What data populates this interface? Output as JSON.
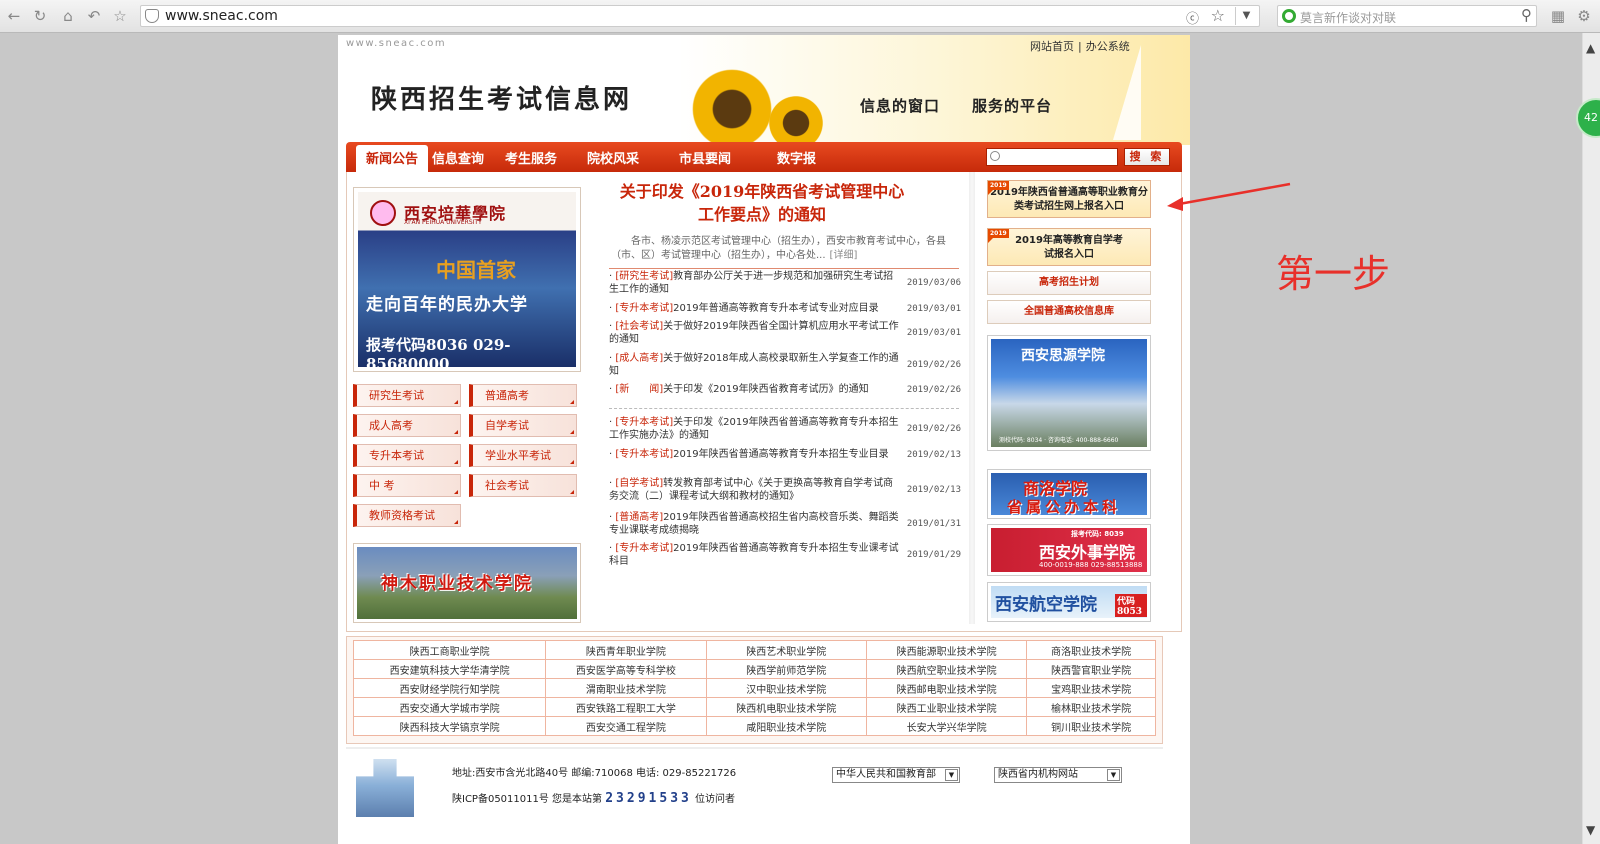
{
  "browser": {
    "url": "www.sneac.com",
    "search_placeholder": "莫言新作谈对对联",
    "badge": "42"
  },
  "site": {
    "domain_mark": "www.sneac.com",
    "title": "陕西招生考试信息网",
    "slogan_left": "信息的窗口",
    "slogan_right": "服务的平台",
    "top_links": [
      "网站首页",
      "办公系统"
    ]
  },
  "nav": {
    "items": [
      "新闻公告",
      "信息查询",
      "考生服务",
      "院校风采",
      "市县要闻",
      "数字报"
    ],
    "search_button": "搜 索"
  },
  "left": {
    "top_ad": {
      "name": "西安培華學院",
      "name_en": "XI'AN PEIHUA UNIVERSITY",
      "slogan_hand": "中国首家",
      "slogan": "走向百年的民办大学",
      "code": "报考代码8036  029-85680000"
    },
    "links": [
      "研究生考试",
      "普通高考",
      "成人高考",
      "自学考试",
      "专升本考试",
      "学业水平考试",
      "中  考",
      "社会考试",
      "教师资格考试"
    ],
    "bottom_ad": "神木职业技术学院"
  },
  "middle": {
    "headline": "关于印发《2019年陕西省考试管理中心工作要点》的通知",
    "summary": "各市、杨凌示范区考试管理中心（招生办），西安市教育考试中心，各县（市、区）考试管理中心（招生办），中心各处...",
    "summary_more": "[详细]",
    "news1": [
      {
        "cat": "[研究生考试]",
        "text": "教育部办公厅关于进一步规范和加强研究生考试招生工作的通知",
        "date": "2019/03/06"
      },
      {
        "cat": "[专升本考试]",
        "text": "2019年普通高等教育专升本考试专业对应目录",
        "date": "2019/03/01"
      },
      {
        "cat": "[社会考试]",
        "text": "关于做好2019年陕西省全国计算机应用水平考试工作的通知",
        "date": "2019/03/01"
      },
      {
        "cat": "[成人高考]",
        "text": "关于做好2018年成人高校录取新生入学复查工作的通知",
        "date": "2019/02/26"
      },
      {
        "cat": "[新　　闻]",
        "text": "关于印发《2019年陕西省教育考试历》的通知",
        "date": "2019/02/26"
      }
    ],
    "news2": [
      {
        "cat": "[专升本考试]",
        "text": "关于印发《2019年陕西省普通高等教育专升本招生工作实施办法》的通知",
        "date": "2019/02/26"
      },
      {
        "cat": "[专升本考试]",
        "text": "2019年陕西省普通高等教育专升本招生专业目录",
        "date": "2019/02/13"
      },
      {
        "cat": "[自学考试]",
        "text": "转发教育部考试中心《关于更换高等教育自学考试商务交流（二）课程考试大纲和教材的通知》",
        "date": "2019/02/13"
      },
      {
        "cat": "[普通高考]",
        "text": "2019年陕西省普通高校招生省内高校音乐类、舞蹈类专业课联考成绩揭晓",
        "date": "2019/01/31"
      },
      {
        "cat": "[专升本考试]",
        "text": "2019年陕西省普通高等教育专升本招生专业课考试科目",
        "date": "2019/01/29"
      }
    ]
  },
  "right": {
    "box1_tag": "2019",
    "box1": "2019年陕西省普通高等职业教育分类考试招生网上报名入口",
    "box2_tag": "2019",
    "box2": "2019年高等教育自学考试报名入口",
    "btn1": "高考招生计划",
    "btn2": "全国普通高校信息库",
    "ad1": "西安思源学院",
    "ad1_sub": "测校代码: 8034 · 咨询电话: 400-888-6660",
    "ad2_line1": "商洛学院",
    "ad2_line2": "省属公办本科",
    "ad3": "西安外事学院",
    "ad3_code": "报考代码: 8039",
    "ad3_phone": "400-0019-888 029-88513888",
    "ad4": "西安航空学院",
    "ad4_code": "代码8053"
  },
  "schools": [
    [
      "陕西工商职业学院",
      "陕西青年职业学院",
      "陕西艺术职业学院",
      "陕西能源职业技术学院",
      "商洛职业技术学院"
    ],
    [
      "西安建筑科技大学华清学院",
      "西安医学高等专科学校",
      "陕西学前师范学院",
      "陕西航空职业技术学院",
      "陕西警官职业学院"
    ],
    [
      "西安财经学院行知学院",
      "渭南职业技术学院",
      "汉中职业技术学院",
      "陕西邮电职业技术学院",
      "宝鸡职业技术学院"
    ],
    [
      "西安交通大学城市学院",
      "西安铁路工程职工大学",
      "陕西机电职业技术学院",
      "陕西工业职业技术学院",
      "榆林职业技术学院"
    ],
    [
      "陕西科技大学镐京学院",
      "西安交通工程学院",
      "咸阳职业技术学院",
      "长安大学兴华学院",
      "铜川职业技术学院"
    ]
  ],
  "footer": {
    "address": "地址:西安市含光北路40号  邮编:710068  电话: 029-85221726",
    "icp": "陕ICP备05011011号  您是本站第",
    "counter": "23291533",
    "visitor": "位访问者",
    "select1": "中华人民共和国教育部",
    "select2": "陕西省内机构网站"
  },
  "annotation": {
    "label": "第一步",
    "color": "#e8302a"
  }
}
